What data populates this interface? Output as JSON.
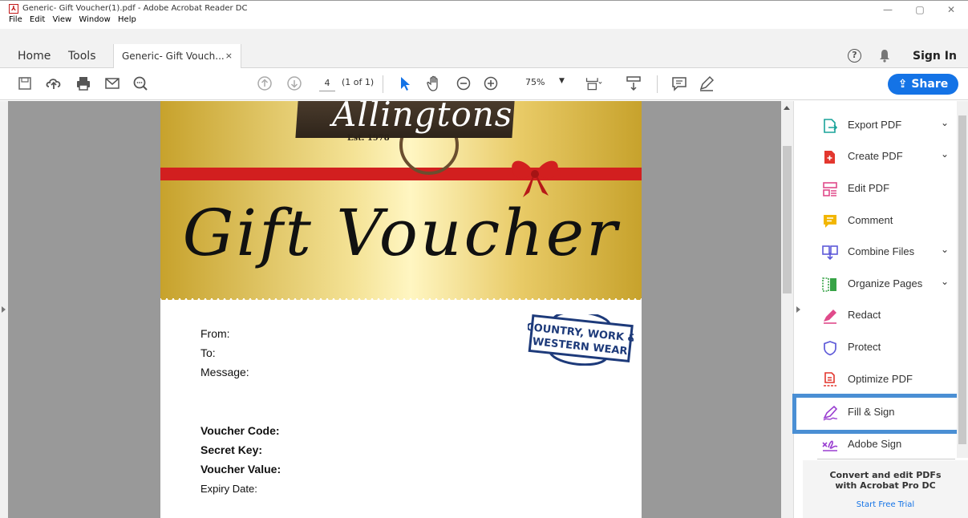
{
  "window": {
    "title": "Generic- Gift Voucher(1).pdf - Adobe Acrobat Reader DC",
    "minimize": "—",
    "maximize": "▢",
    "close": "✕"
  },
  "menu": [
    "File",
    "Edit",
    "View",
    "Window",
    "Help"
  ],
  "tabs": {
    "home": "Home",
    "tools": "Tools",
    "doc": "Generic- Gift Vouch...",
    "doc_close": "×",
    "sign_in": "Sign In"
  },
  "toolbar": {
    "page_number": "4",
    "page_of": "(1 of 1)",
    "zoom": "75%",
    "share": "Share"
  },
  "document": {
    "logo": "Allingtons",
    "est": "Est. 1978",
    "heading": "Gift Voucher",
    "stamp_line1": "COUNTRY, WORK &",
    "stamp_line2": "WESTERN WEAR",
    "from": "From:",
    "to": "To:",
    "message": "Message:",
    "voucher_code": "Voucher Code:",
    "secret_key": "Secret Key:",
    "voucher_value": "Voucher Value:",
    "expiry_date": "Expiry Date:"
  },
  "tools": [
    {
      "label": "Export PDF",
      "icon": "export-pdf-icon",
      "color": "#1aa39a"
    },
    {
      "label": "Create PDF",
      "icon": "create-pdf-icon",
      "color": "#e3372e"
    },
    {
      "label": "Edit PDF",
      "icon": "edit-pdf-icon",
      "color": "#e04a8a"
    },
    {
      "label": "Comment",
      "icon": "comment-icon",
      "color": "#f2b600"
    },
    {
      "label": "Combine Files",
      "icon": "combine-files-icon",
      "color": "#5d59d8"
    },
    {
      "label": "Organize Pages",
      "icon": "organize-pages-icon",
      "color": "#37a346"
    },
    {
      "label": "Redact",
      "icon": "redact-icon",
      "color": "#e04a8a"
    },
    {
      "label": "Protect",
      "icon": "protect-icon",
      "color": "#5d59d8"
    },
    {
      "label": "Optimize PDF",
      "icon": "optimize-pdf-icon",
      "color": "#e3372e"
    },
    {
      "label": "Fill & Sign",
      "icon": "fill-sign-icon",
      "color": "#9a3fd1"
    },
    {
      "label": "Adobe Sign",
      "icon": "adobe-sign-icon",
      "color": "#9a3fd1"
    }
  ],
  "promo": {
    "line1": "Convert and edit PDFs",
    "line2": "with Acrobat Pro DC",
    "link": "Start Free Trial"
  },
  "colors": {
    "accent": "#1473e6",
    "highlight": "#4a8fd4"
  }
}
